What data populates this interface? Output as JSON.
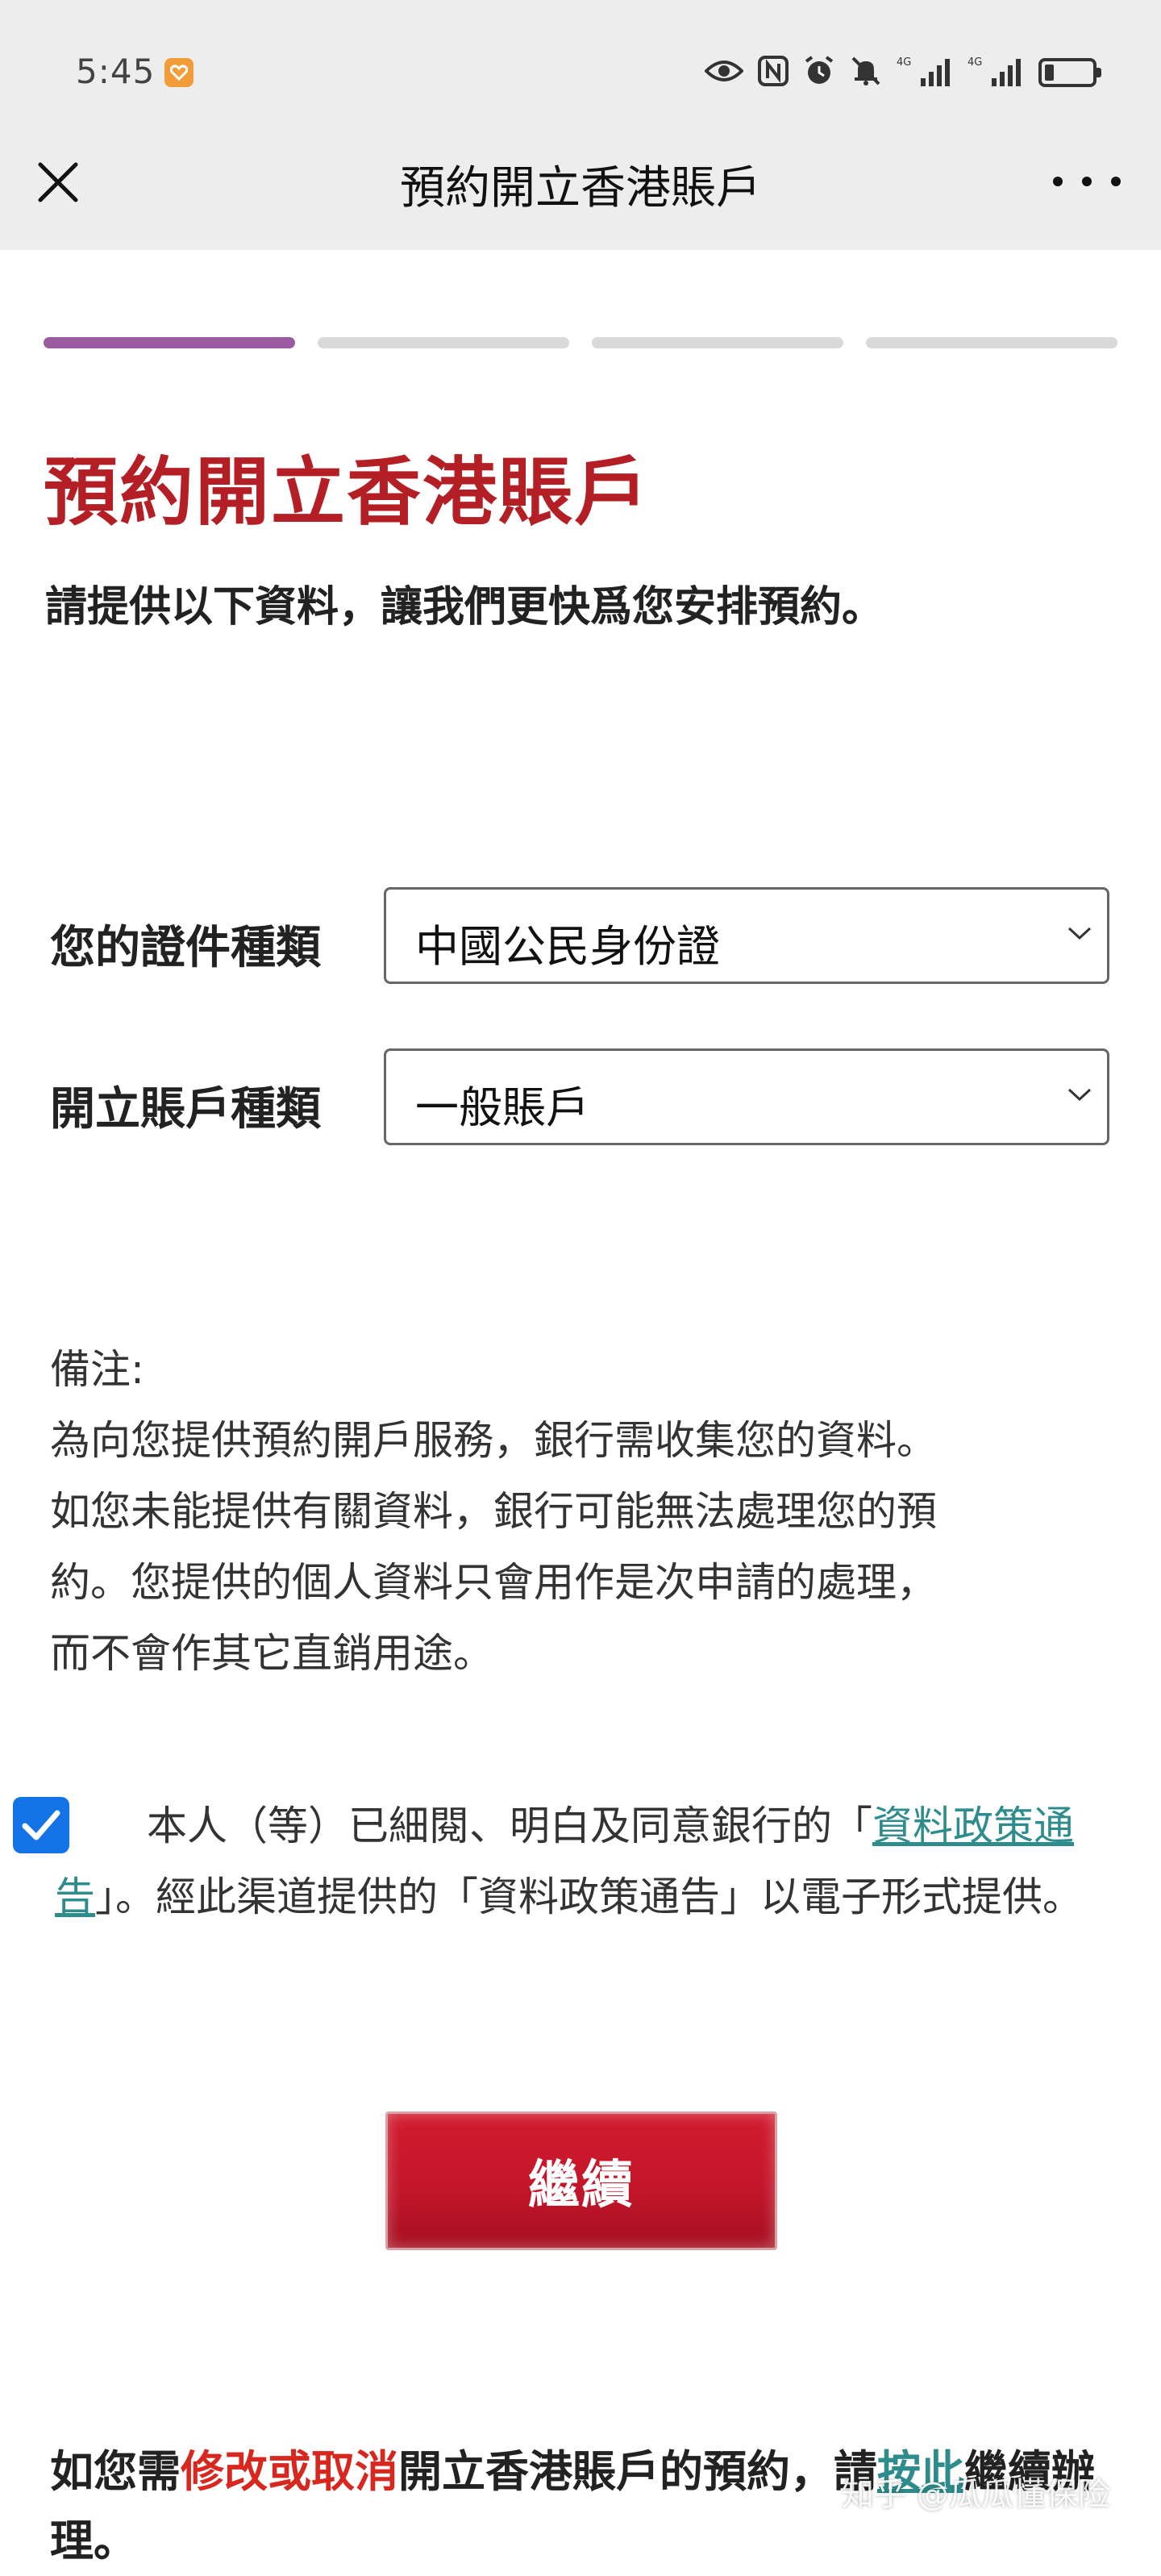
{
  "status_bar": {
    "time": "5:45",
    "icons": [
      "eye-icon",
      "nfc-icon",
      "alarm-icon",
      "mute-icon",
      "signal-4g-icon",
      "signal-4g-icon",
      "battery-icon"
    ],
    "battery_level": 0.2
  },
  "navbar": {
    "title": "預約開立香港賬戶",
    "close_icon": "close-icon",
    "more_icon": "more-icon"
  },
  "progress": {
    "total_steps": 4,
    "current_step": 1,
    "active_color": "#9b5ba1"
  },
  "page": {
    "heading": "預約開立香港賬戶",
    "subtitle": "請提供以下資料，讓我們更快爲您安排預約。"
  },
  "form": {
    "id_type": {
      "label": "您的證件種類",
      "value": "中國公民身份證"
    },
    "account_type": {
      "label": "開立賬戶種類",
      "value": "一般賬戶"
    }
  },
  "remarks": {
    "title": "備注:",
    "body_lines": [
      "為向您提供預約開戶服務，銀行需收集您的資料。",
      "如您未能提供有關資料，銀行可能無法處理您的預",
      "約。您提供的個人資料只會用作是次申請的處理，",
      "而不會作其它直銷用途。"
    ]
  },
  "consent": {
    "checked": true,
    "text_before": "本人（等）已細閱、明白及同意銀行的「",
    "link_text": "資料政策通告",
    "text_after": "」。經此渠道提供的「資料政策通告」以電子形式提供。"
  },
  "continue_button": {
    "label": "繼續"
  },
  "footer": {
    "prefix": "如您需",
    "highlight": "修改或取消",
    "middle": "開立香港賬戶的預約，請",
    "link_text": "按此",
    "suffix": "繼續辦理。"
  },
  "watermark": "知乎 @瓜瓜懂保险",
  "colors": {
    "brand_red": "#b31f24",
    "button_red": "#c4162a",
    "link_teal": "#2e8c8c",
    "checkbox_blue": "#1473e6",
    "bar_gray": "#ededed"
  }
}
